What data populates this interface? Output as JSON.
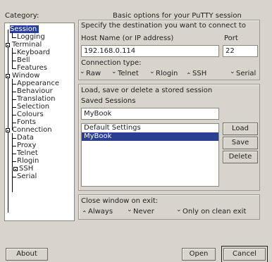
{
  "category_label": "Category:",
  "panel_title": "Basic options for your PuTTY session",
  "tree": [
    {
      "label": "Session",
      "selected": true
    },
    {
      "label": "Logging"
    },
    {
      "label": "Terminal"
    },
    {
      "label": "Keyboard"
    },
    {
      "label": "Bell"
    },
    {
      "label": "Features"
    },
    {
      "label": "Window"
    },
    {
      "label": "Appearance"
    },
    {
      "label": "Behaviour"
    },
    {
      "label": "Translation"
    },
    {
      "label": "Selection"
    },
    {
      "label": "Colours"
    },
    {
      "label": "Fonts"
    },
    {
      "label": "Connection"
    },
    {
      "label": "Data"
    },
    {
      "label": "Proxy"
    },
    {
      "label": "Telnet"
    },
    {
      "label": "Rlogin"
    },
    {
      "label": "SSH"
    },
    {
      "label": "Serial"
    }
  ],
  "destination": {
    "heading": "Specify the destination you want to connect to",
    "host_label": "Host Name (or IP address)",
    "host_value": "192.168.0.114",
    "port_label": "Port",
    "port_value": "22",
    "conn_type_label": "Connection type:",
    "conn_types": [
      "Raw",
      "Telnet",
      "Rlogin",
      "SSH",
      "Serial"
    ],
    "conn_type_selected": "SSH"
  },
  "sessions": {
    "heading": "Load, save or delete a stored session",
    "saved_label": "Saved Sessions",
    "saved_value": "MyBook",
    "list": [
      "Default Settings",
      "MyBook"
    ],
    "selected": "MyBook",
    "load_label": "Load",
    "save_label": "Save",
    "delete_label": "Delete"
  },
  "close_window": {
    "label": "Close window on exit:",
    "options": [
      "Always",
      "Never",
      "Only on clean exit"
    ],
    "selected": "Always"
  },
  "buttons": {
    "about": "About",
    "open": "Open",
    "cancel": "Cancel"
  },
  "colors": {
    "selection": "#2a3f8f",
    "background": "#d8d4cc"
  }
}
